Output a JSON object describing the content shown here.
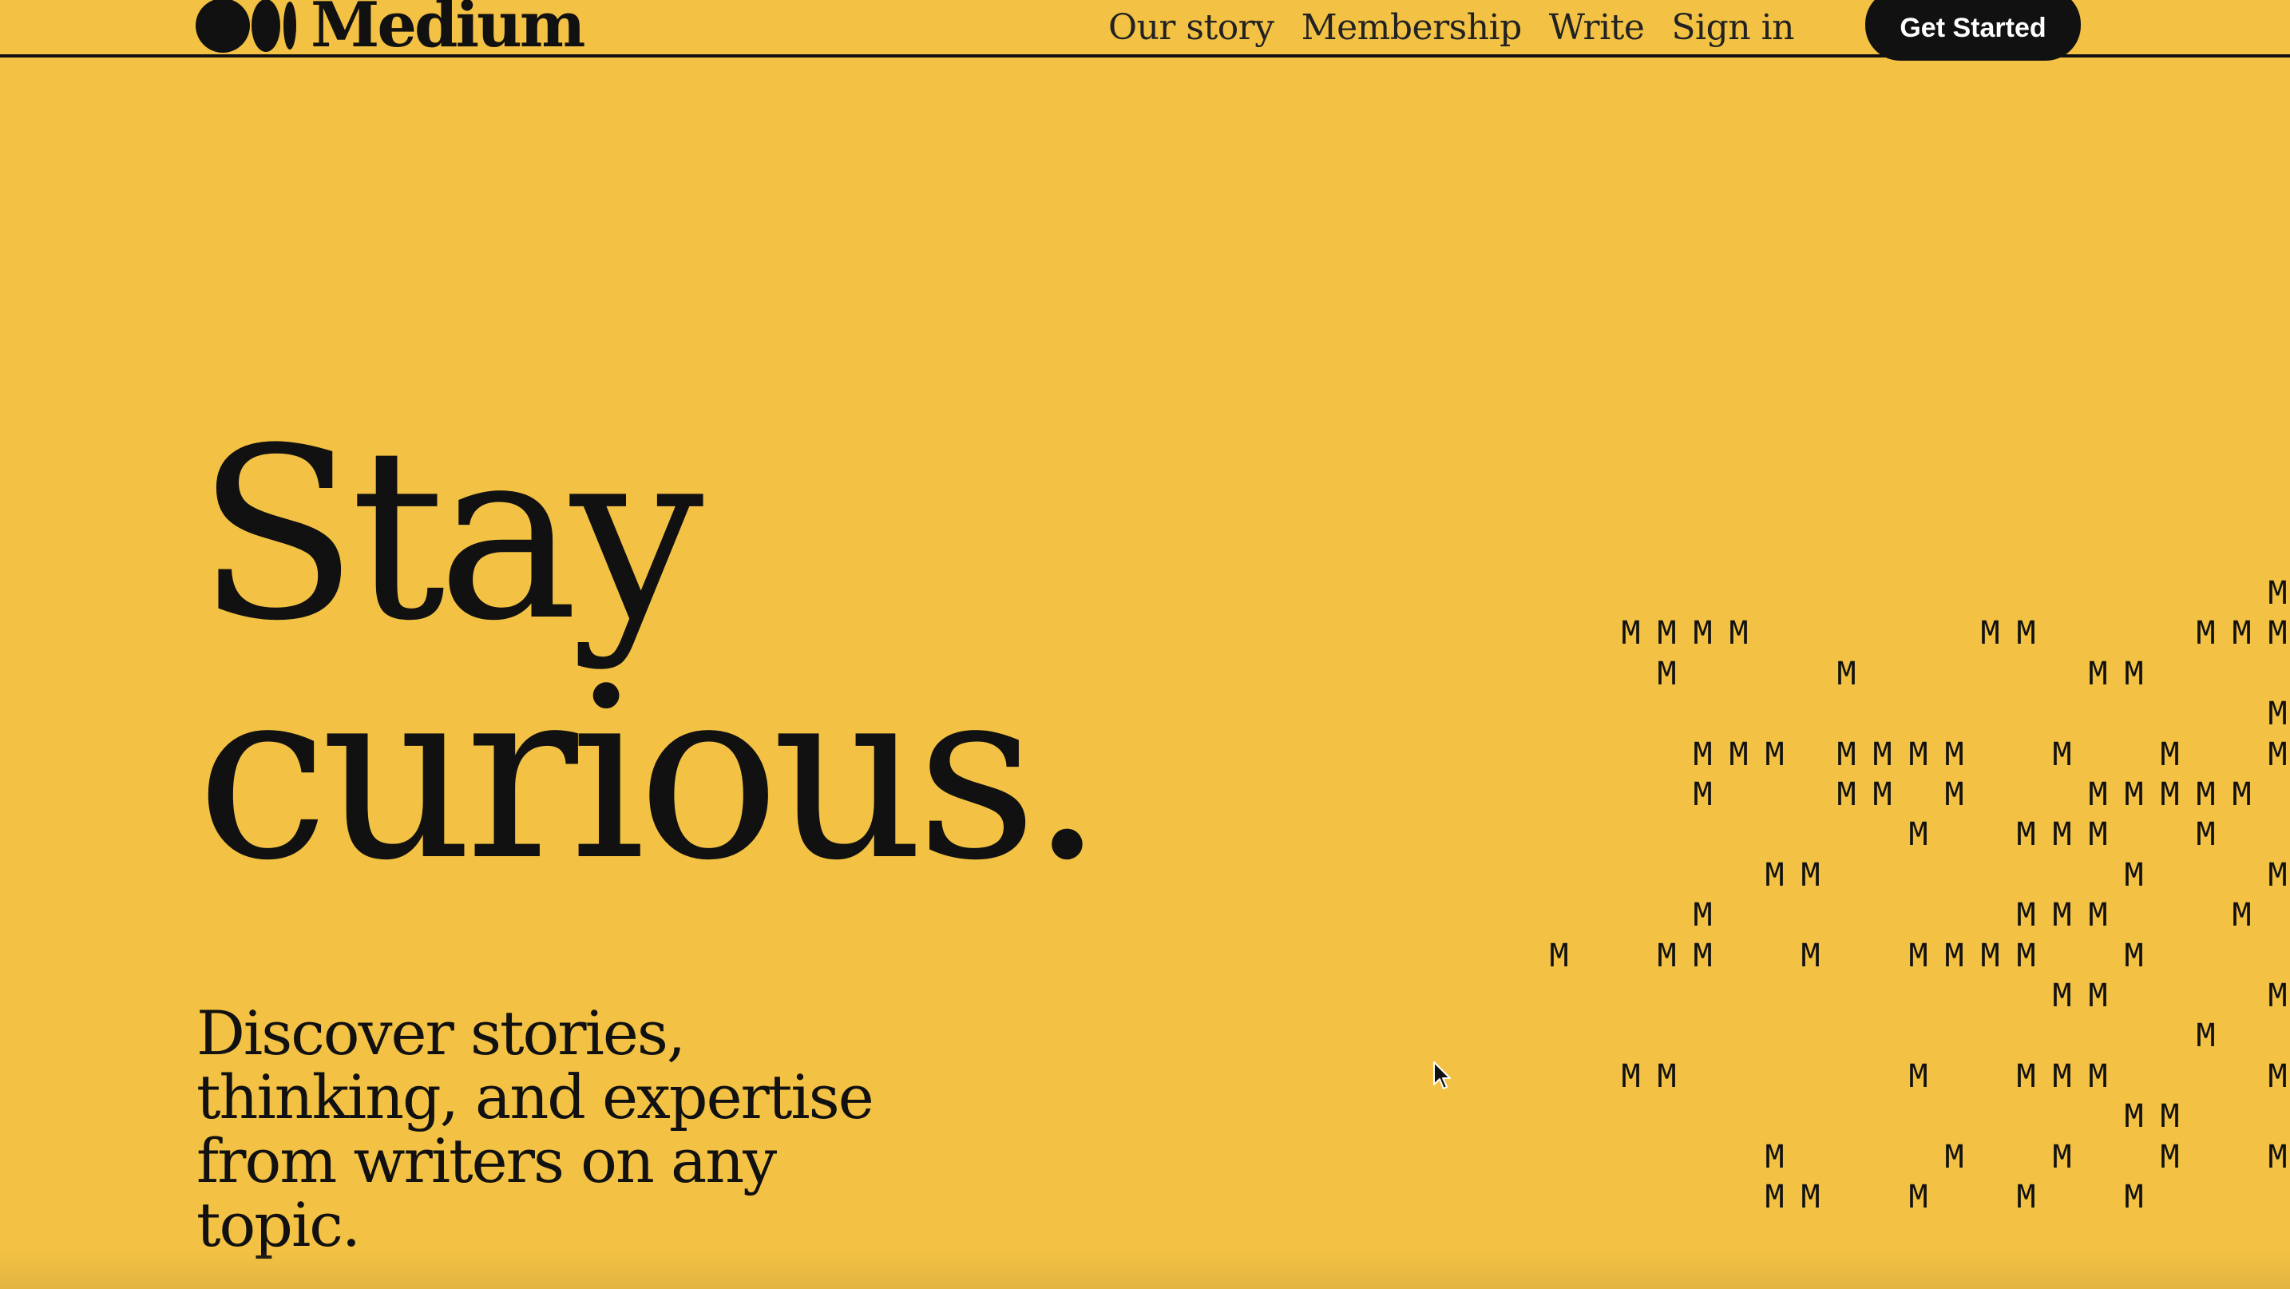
{
  "brand": {
    "name": "Medium",
    "logo_icon": "medium-logo-icon"
  },
  "nav": {
    "links": [
      "Our story",
      "Membership",
      "Write",
      "Sign in"
    ],
    "cta_label": "Get Started"
  },
  "hero": {
    "headline_line1": "Stay",
    "headline_line2": "curious.",
    "subheading": "Discover stories, thinking, and expertise from writers on any topic."
  },
  "decoration": {
    "glyph": "M",
    "rows": [
      "                    M MMMMM",
      "  MMMM      MM    MMMMM    M",
      "   M    M      MM          MM",
      "                    MMM",
      "    MMM MMMM  M  M  M     MM",
      "    M   MM M   MMMMM  MM",
      "          M  MMM  M  M  M  M",
      "      MM        M   M  MMM",
      "    M        MMM   M  M",
      "M  MM  M  MMMM  M    MMMM",
      "              MM    MM  M",
      "                  M   M  MM",
      "  MM      M  MMM    MM  M",
      "                MM    MMM",
      "      M    M  M  M  MMMM",
      "      MM  M  M  M    M    M"
    ]
  },
  "colors": {
    "background": "#f3c244",
    "text": "#111111",
    "button_bg": "#111111",
    "button_text": "#ffffff"
  },
  "cursor_icon": "mouse-pointer-icon"
}
